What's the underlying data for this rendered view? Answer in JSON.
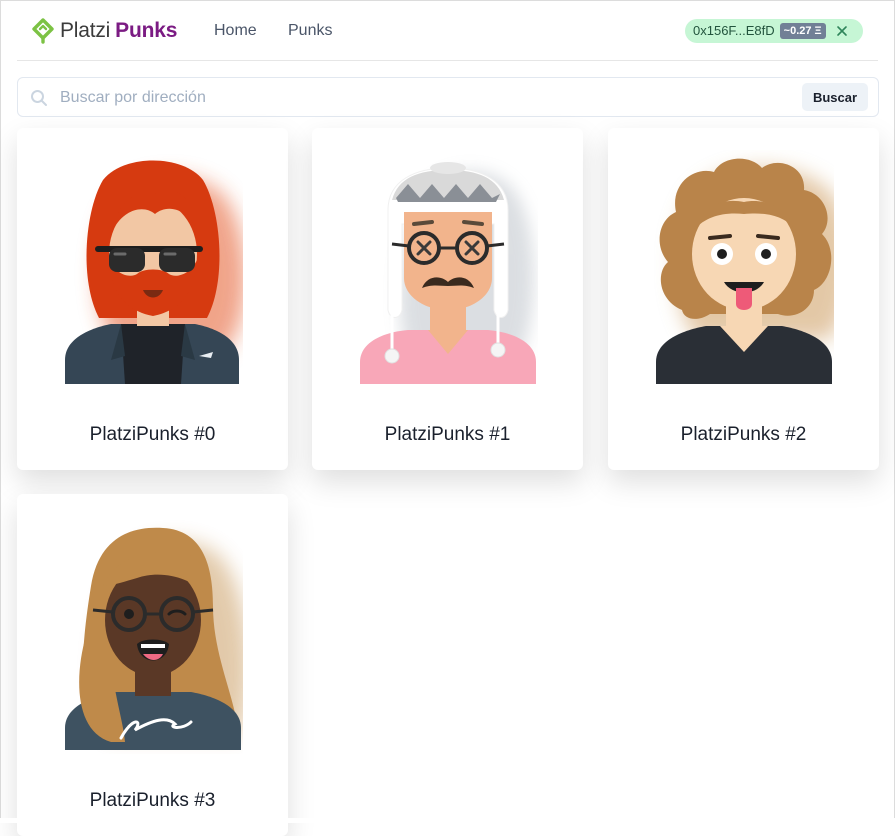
{
  "navbar": {
    "brand": {
      "part1": "Platzi",
      "part2": "Punks"
    },
    "links": [
      {
        "label": "Home"
      },
      {
        "label": "Punks"
      }
    ],
    "wallet": {
      "address": "0x156F...E8fD",
      "balance": "~0.27 Ξ"
    }
  },
  "search": {
    "placeholder": "Buscar por dirección",
    "value": "",
    "button_label": "Buscar"
  },
  "punks": [
    {
      "name": "PlatziPunks #0"
    },
    {
      "name": "PlatziPunks #1"
    },
    {
      "name": "PlatziPunks #2"
    },
    {
      "name": "PlatziPunks #3"
    }
  ],
  "colors": {
    "brand_green": "#7cc244",
    "brand_purple": "#7b1b83",
    "wallet_bg": "#c6f6d5",
    "punk0_hair": "#d63a10",
    "punk2_hair": "#b9844a",
    "punk3_hair": "#bf8a4a"
  }
}
